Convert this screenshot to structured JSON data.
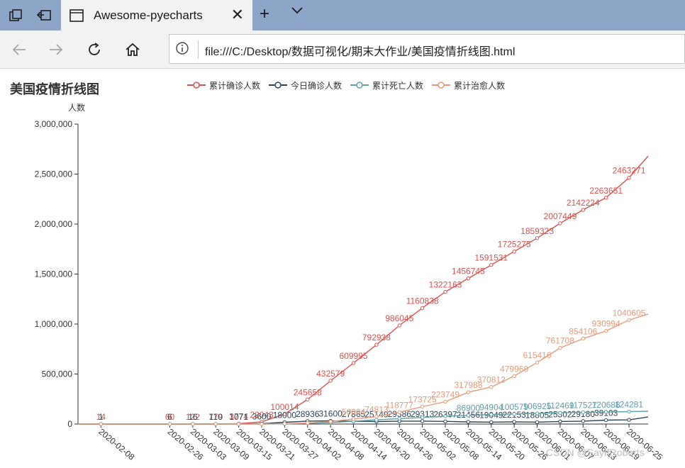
{
  "browser": {
    "tab_title": "Awesome-pyecharts",
    "url": "file:///C:/Desktop/数据可视化/期末大作业/美国疫情折线图.html"
  },
  "watermark": "CSDN @SayIfRoberts",
  "chart_data": {
    "type": "line",
    "title": "美国疫情折线图",
    "ylabel": "人数",
    "xlabel": "",
    "ylim": [
      0,
      3000000
    ],
    "yticks": [
      "0",
      "500,000",
      "1,000,000",
      "1,500,000",
      "2,000,000",
      "2,500,000",
      "3,000,000"
    ],
    "ytick_values": [
      0,
      500000,
      1000000,
      1500000,
      2000000,
      2500000,
      3000000
    ],
    "xlim": [
      "2020-02-02",
      "2020-06-30"
    ],
    "x_tick_labels": [
      "2020-02-08",
      "2020-02-26",
      "2020-03-03",
      "2020-03-09",
      "2020-03-15",
      "2020-03-21",
      "2020-03-27",
      "2020-04-02",
      "2020-04-08",
      "2020-04-14",
      "2020-04-20",
      "2020-04-26",
      "2020-05-02",
      "2020-05-08",
      "2020-05-14",
      "2020-05-20",
      "2020-05-26",
      "2020-06-01",
      "2020-06-07",
      "2020-06-13",
      "2020-06-19",
      "2020-06-25"
    ],
    "legend_position": "top",
    "grid": false,
    "series": [
      {
        "name": "累计确诊人数",
        "color": "#d9534f",
        "x": [
          "2020-02-02",
          "2020-02-08",
          "2020-02-26",
          "2020-03-03",
          "2020-03-09",
          "2020-03-15",
          "2020-03-21",
          "2020-03-27",
          "2020-04-02",
          "2020-04-08",
          "2020-04-14",
          "2020-04-20",
          "2020-04-26",
          "2020-05-02",
          "2020-05-08",
          "2020-05-14",
          "2020-05-20",
          "2020-05-26",
          "2020-06-01",
          "2020-06-07",
          "2020-06-13",
          "2020-06-19",
          "2020-06-25",
          "2020-06-30"
        ],
        "y": [
          14,
          14,
          60,
          122,
          779,
          3774,
          22043,
          100014,
          245658,
          432579,
          609995,
          792938,
          986045,
          1160838,
          1322163,
          1456745,
          1591531,
          1725275,
          1859323,
          2007449,
          2142224,
          2263651,
          2463271,
          2680000
        ],
        "labels": [
          "",
          "14",
          "60",
          "122",
          "779",
          "3774",
          "22043",
          "100014",
          "245658",
          "432579",
          "609995",
          "792938",
          "986045",
          "1160838",
          "1322163",
          "1456745",
          "1591531",
          "1725275",
          "1859323",
          "2007449",
          "2142224",
          "2263651",
          "2463271",
          ""
        ]
      },
      {
        "name": "今日确诊人数",
        "color": "#2f4554",
        "x": [
          "2020-02-02",
          "2020-02-08",
          "2020-02-26",
          "2020-03-03",
          "2020-03-09",
          "2020-03-15",
          "2020-03-21",
          "2020-03-27",
          "2020-04-02",
          "2020-04-08",
          "2020-04-14",
          "2020-04-20",
          "2020-04-26",
          "2020-05-02",
          "2020-05-08",
          "2020-05-14",
          "2020-05-20",
          "2020-05-26",
          "2020-06-01",
          "2020-06-07",
          "2020-06-13",
          "2020-06-19",
          "2020-06-25",
          "2020-06-30"
        ],
        "y": [
          1,
          1,
          6,
          16,
          110,
          1071,
          3600,
          18000,
          28936,
          31600,
          27865,
          25149,
          29386,
          29313,
          26397,
          21456,
          19049,
          22153,
          18805,
          25302,
          29180,
          39103,
          42000,
          70000
        ],
        "labels": [
          "",
          "1",
          "6",
          "16",
          "110",
          "1071",
          "3600",
          "18000",
          "28936",
          "31600",
          "27865",
          "25149",
          "29386",
          "29313",
          "26397",
          "21456",
          "19049",
          "22153",
          "18805",
          "25302",
          "29180",
          "39103",
          "",
          ""
        ]
      },
      {
        "name": "累计死亡人数",
        "color": "#61a0a8",
        "x": [
          "2020-02-02",
          "2020-02-08",
          "2020-02-26",
          "2020-03-03",
          "2020-03-09",
          "2020-03-15",
          "2020-03-21",
          "2020-03-27",
          "2020-04-02",
          "2020-04-08",
          "2020-04-14",
          "2020-04-20",
          "2020-04-26",
          "2020-05-02",
          "2020-05-08",
          "2020-05-14",
          "2020-05-20",
          "2020-05-26",
          "2020-06-01",
          "2020-06-07",
          "2020-06-13",
          "2020-06-19",
          "2020-06-25",
          "2020-06-30"
        ],
        "y": [
          0,
          0,
          0,
          6,
          22,
          69,
          282,
          1478,
          6100,
          14778,
          27805,
          41830,
          54141,
          65913,
          78169,
          86900,
          94904,
          100579,
          106925,
          112469,
          117527,
          120688,
          124281,
          128000
        ],
        "labels": [
          "",
          "",
          "",
          "",
          "",
          "",
          "",
          "",
          "",
          "",
          "",
          "",
          "",
          "",
          "",
          "86900",
          "94904",
          "100579",
          "106925",
          "112469",
          "117527",
          "120688",
          "124281",
          ""
        ]
      },
      {
        "name": "累计治愈人数",
        "color": "#e69a7a",
        "x": [
          "2020-02-02",
          "2020-02-08",
          "2020-02-26",
          "2020-03-03",
          "2020-03-09",
          "2020-03-15",
          "2020-03-21",
          "2020-03-27",
          "2020-04-02",
          "2020-04-08",
          "2020-04-14",
          "2020-04-20",
          "2020-04-26",
          "2020-05-02",
          "2020-05-08",
          "2020-05-14",
          "2020-05-20",
          "2020-05-26",
          "2020-06-01",
          "2020-06-07",
          "2020-06-13",
          "2020-06-19",
          "2020-06-25",
          "2020-06-30"
        ],
        "y": [
          0,
          3,
          7,
          8,
          15,
          125,
          500,
          3500,
          9800,
          25000,
          50004,
          74813,
          118777,
          173725,
          223749,
          317988,
          370812,
          479969,
          615416,
          761708,
          854106,
          930994,
          1040605,
          1100000
        ],
        "labels": [
          "",
          "",
          "",
          "",
          "",
          "",
          "",
          "",
          "",
          "",
          "50004",
          "74813",
          "118777",
          "173725",
          "223749",
          "317988",
          "370812",
          "479969",
          "615416",
          "761708",
          "854106",
          "930994",
          "1040605",
          ""
        ]
      }
    ]
  }
}
